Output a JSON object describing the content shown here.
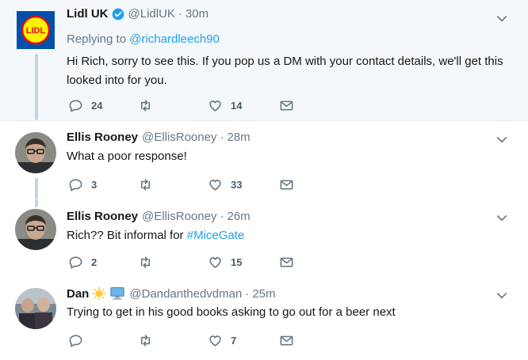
{
  "tweets": [
    {
      "name": "Lidl UK",
      "handle": "@LidlUK",
      "separator": "·",
      "time": "30m",
      "verified": true,
      "replying_prefix": "Replying to",
      "replying_handle": "@richardleech90",
      "text": "Hi Rich, sorry to see this. If you pop us a DM with your contact details, we'll get this looked into for you.",
      "replies": "24",
      "retweets": "",
      "likes": "14",
      "logo_text": "LIDL"
    },
    {
      "name": "Ellis Rooney",
      "handle": "@EllisRooney",
      "separator": "·",
      "time": "28m",
      "text": "What a poor response!",
      "replies": "3",
      "retweets": "",
      "likes": "33"
    },
    {
      "name": "Ellis Rooney",
      "handle": "@EllisRooney",
      "separator": "·",
      "time": "26m",
      "text_prefix": "Rich?? Bit informal for ",
      "hashtag": "#MiceGate",
      "replies": "2",
      "retweets": "",
      "likes": "15"
    },
    {
      "name": "Dan",
      "handle": "@Dandanthedvdman",
      "separator": "·",
      "time": "25m",
      "name_emojis": [
        "sun-emoji",
        "computer-emoji"
      ],
      "text": "Trying to get in his good books asking to go out for a beer next",
      "replies": "",
      "retweets": "",
      "likes": "7"
    }
  ],
  "colors": {
    "link": "#1da1f2",
    "muted": "#657786",
    "thread_line": "#c4d5e3",
    "highlight_bg": "#f5f8fa"
  }
}
